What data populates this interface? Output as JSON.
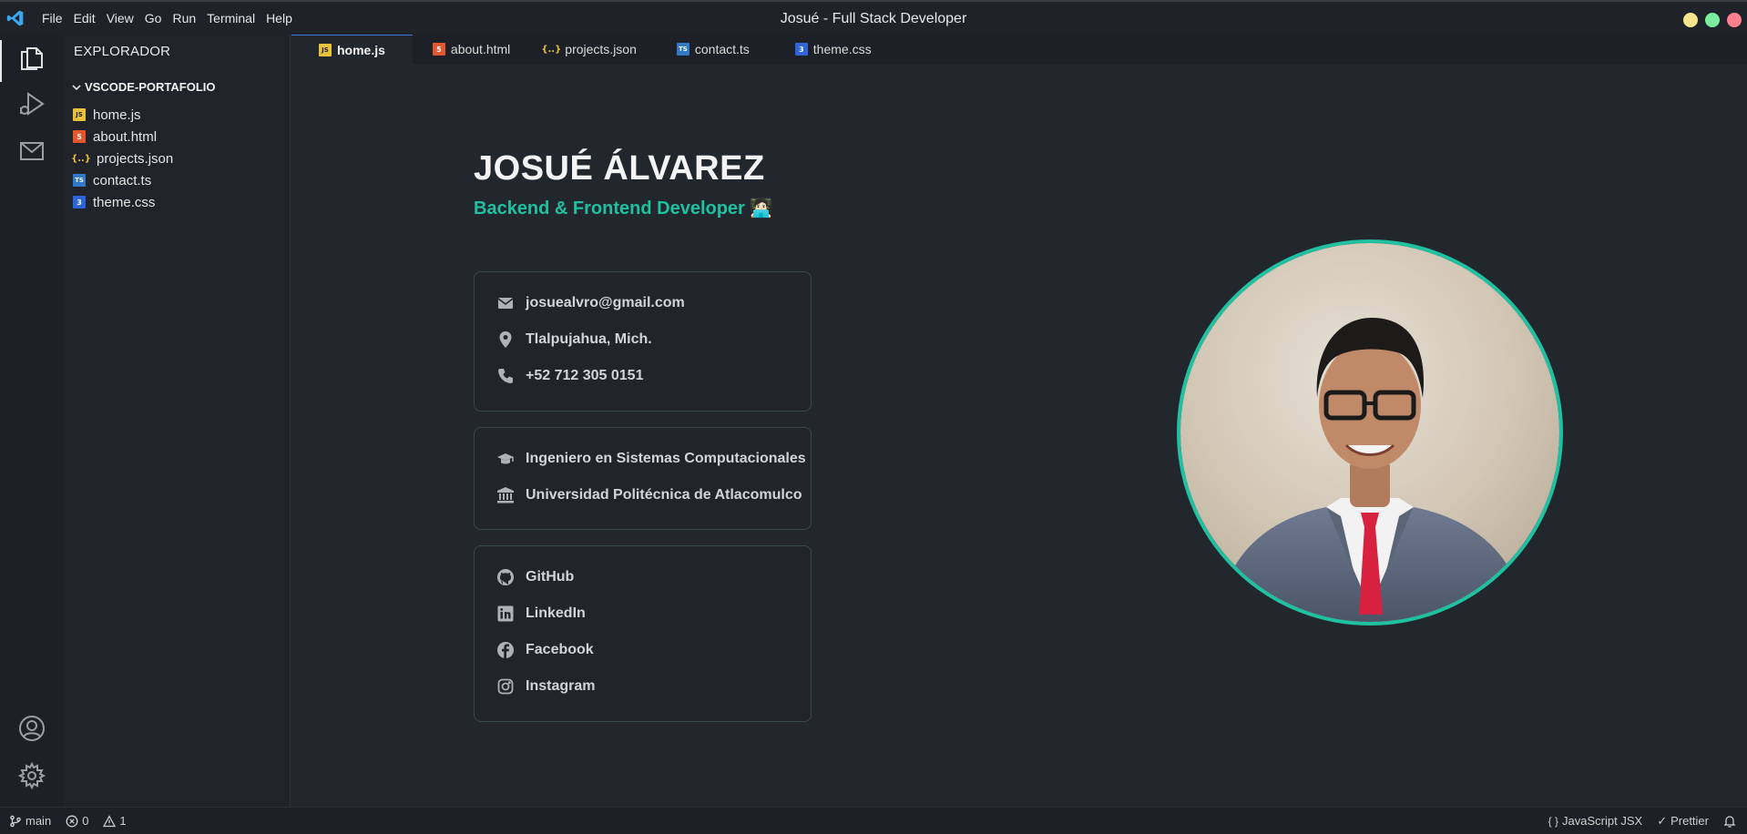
{
  "window": {
    "title": "Josué - Full Stack Developer",
    "menu": [
      "File",
      "Edit",
      "View",
      "Go",
      "Run",
      "Terminal",
      "Help"
    ],
    "traffic_colors": [
      "#f6e58d",
      "#7bed9f",
      "#ff7f8e"
    ]
  },
  "activity_bar": {
    "top": [
      "files-icon",
      "run-debug-icon",
      "mail-icon"
    ],
    "bottom": [
      "account-icon",
      "gear-icon"
    ]
  },
  "sidebar": {
    "title": "EXPLORADOR",
    "folder": "VSCODE-PORTAFOLIO",
    "files": [
      {
        "name": "home.js",
        "icon": "js-icon",
        "badge": "JS",
        "color": "#e8c23a"
      },
      {
        "name": "about.html",
        "icon": "html-icon",
        "badge": "5",
        "color": "#e4572e"
      },
      {
        "name": "projects.json",
        "icon": "json-icon",
        "badge": "{..}",
        "color": "#e8c23a"
      },
      {
        "name": "contact.ts",
        "icon": "ts-icon",
        "badge": "TS",
        "color": "#3178c6"
      },
      {
        "name": "theme.css",
        "icon": "css-icon",
        "badge": "3",
        "color": "#2f65d9"
      }
    ]
  },
  "tabs": [
    {
      "label": "home.js",
      "active": true
    },
    {
      "label": "about.html",
      "active": false
    },
    {
      "label": "projects.json",
      "active": false
    },
    {
      "label": "contact.ts",
      "active": false
    },
    {
      "label": "theme.css",
      "active": false
    }
  ],
  "profile": {
    "name": "JOSUÉ ÁLVAREZ",
    "role": "Backend & Frontend Developer 🧑🏻‍💻",
    "accent": "#1fc1a0",
    "contact": [
      {
        "icon": "mail-icon",
        "text": "josuealvro@gmail.com"
      },
      {
        "icon": "location-pin-icon",
        "text": "Tlalpujahua, Mich."
      },
      {
        "icon": "phone-icon",
        "text": "+52 712 305 0151"
      }
    ],
    "education": [
      {
        "icon": "graduation-cap-icon",
        "text": "Ingeniero en Sistemas Computacionales"
      },
      {
        "icon": "university-icon",
        "text": "Universidad Politécnica de Atlacomulco"
      }
    ],
    "social": [
      {
        "icon": "github-icon",
        "text": "GitHub"
      },
      {
        "icon": "linkedin-icon",
        "text": "LinkedIn"
      },
      {
        "icon": "facebook-icon",
        "text": "Facebook"
      },
      {
        "icon": "instagram-icon",
        "text": "Instagram"
      }
    ]
  },
  "statusbar": {
    "branch": "main",
    "errors": "0",
    "warnings": "1",
    "language": "JavaScript JSX",
    "formatter": "Prettier"
  }
}
